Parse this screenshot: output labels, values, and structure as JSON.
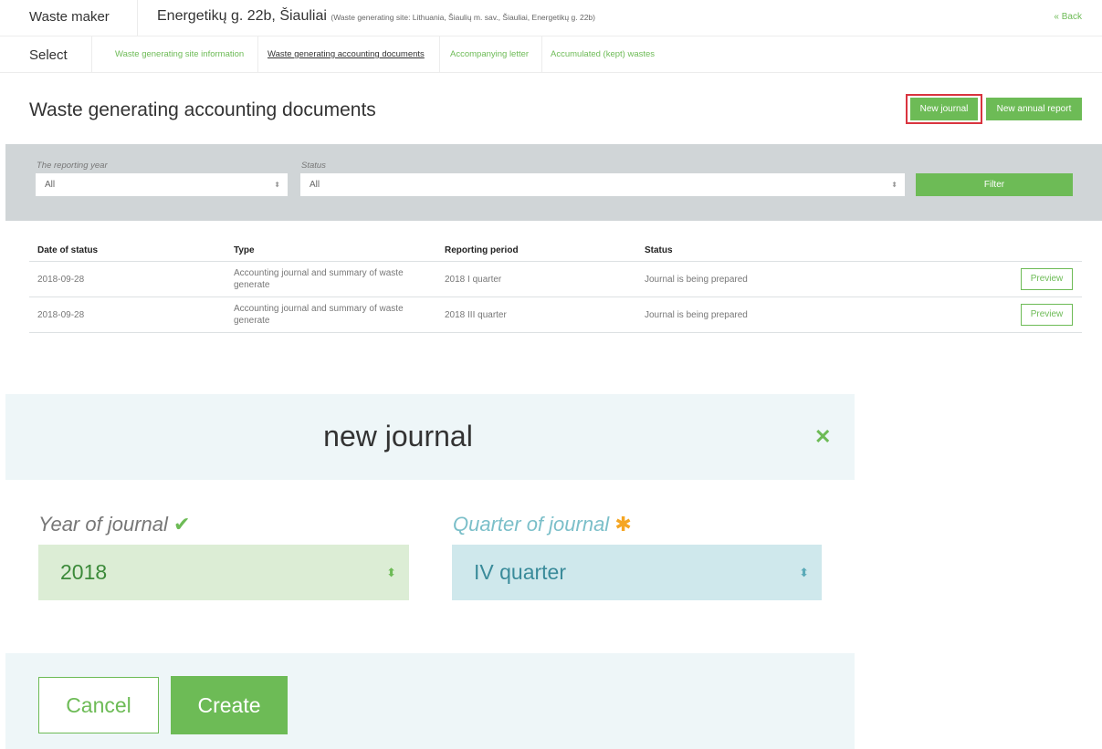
{
  "header": {
    "app_title": "Waste maker",
    "site_name": "Energetikų g. 22b, Šiauliai",
    "site_detail": "(Waste generating site: Lithuania, Šiaulių m. sav., Šiauliai, Energetikų g. 22b)",
    "back_label": "« Back"
  },
  "nav": {
    "select_label": "Select",
    "tabs": [
      {
        "label": "Waste generating site information"
      },
      {
        "label": "Waste generating accounting documents"
      },
      {
        "label": "Accompanying letter"
      },
      {
        "label": "Accumulated (kept) wastes"
      }
    ]
  },
  "page": {
    "title": "Waste generating accounting documents",
    "new_journal_label": "New journal",
    "new_annual_report_label": "New annual report"
  },
  "filter": {
    "year_label": "The reporting year",
    "year_value": "All",
    "status_label": "Status",
    "status_value": "All",
    "button_label": "Filter"
  },
  "table": {
    "columns": [
      "Date of status",
      "Type",
      "Reporting period",
      "Status"
    ],
    "rows": [
      {
        "date": "2018-09-28",
        "type_line1": "Accounting journal and summary of waste",
        "type_line2": "generate",
        "period": "2018 I quarter",
        "status": "Journal is being prepared",
        "action": "Preview"
      },
      {
        "date": "2018-09-28",
        "type_line1": "Accounting journal and summary of waste",
        "type_line2": "generate",
        "period": "2018 III quarter",
        "status": "Journal is being prepared",
        "action": "Preview"
      }
    ]
  },
  "modal": {
    "title": "new journal",
    "close_icon": "close-icon",
    "year_label": "Year of journal",
    "year_value": "2018",
    "quarter_label": "Quarter of journal",
    "quarter_value": "IV quarter",
    "cancel_label": "Cancel",
    "create_label": "Create"
  },
  "colors": {
    "accent_green": "#6dbb56",
    "highlight_red": "#d9343f",
    "valid_field_bg": "#dcedd5",
    "active_field_bg": "#cfe8ec",
    "required_star": "#f5a623"
  }
}
